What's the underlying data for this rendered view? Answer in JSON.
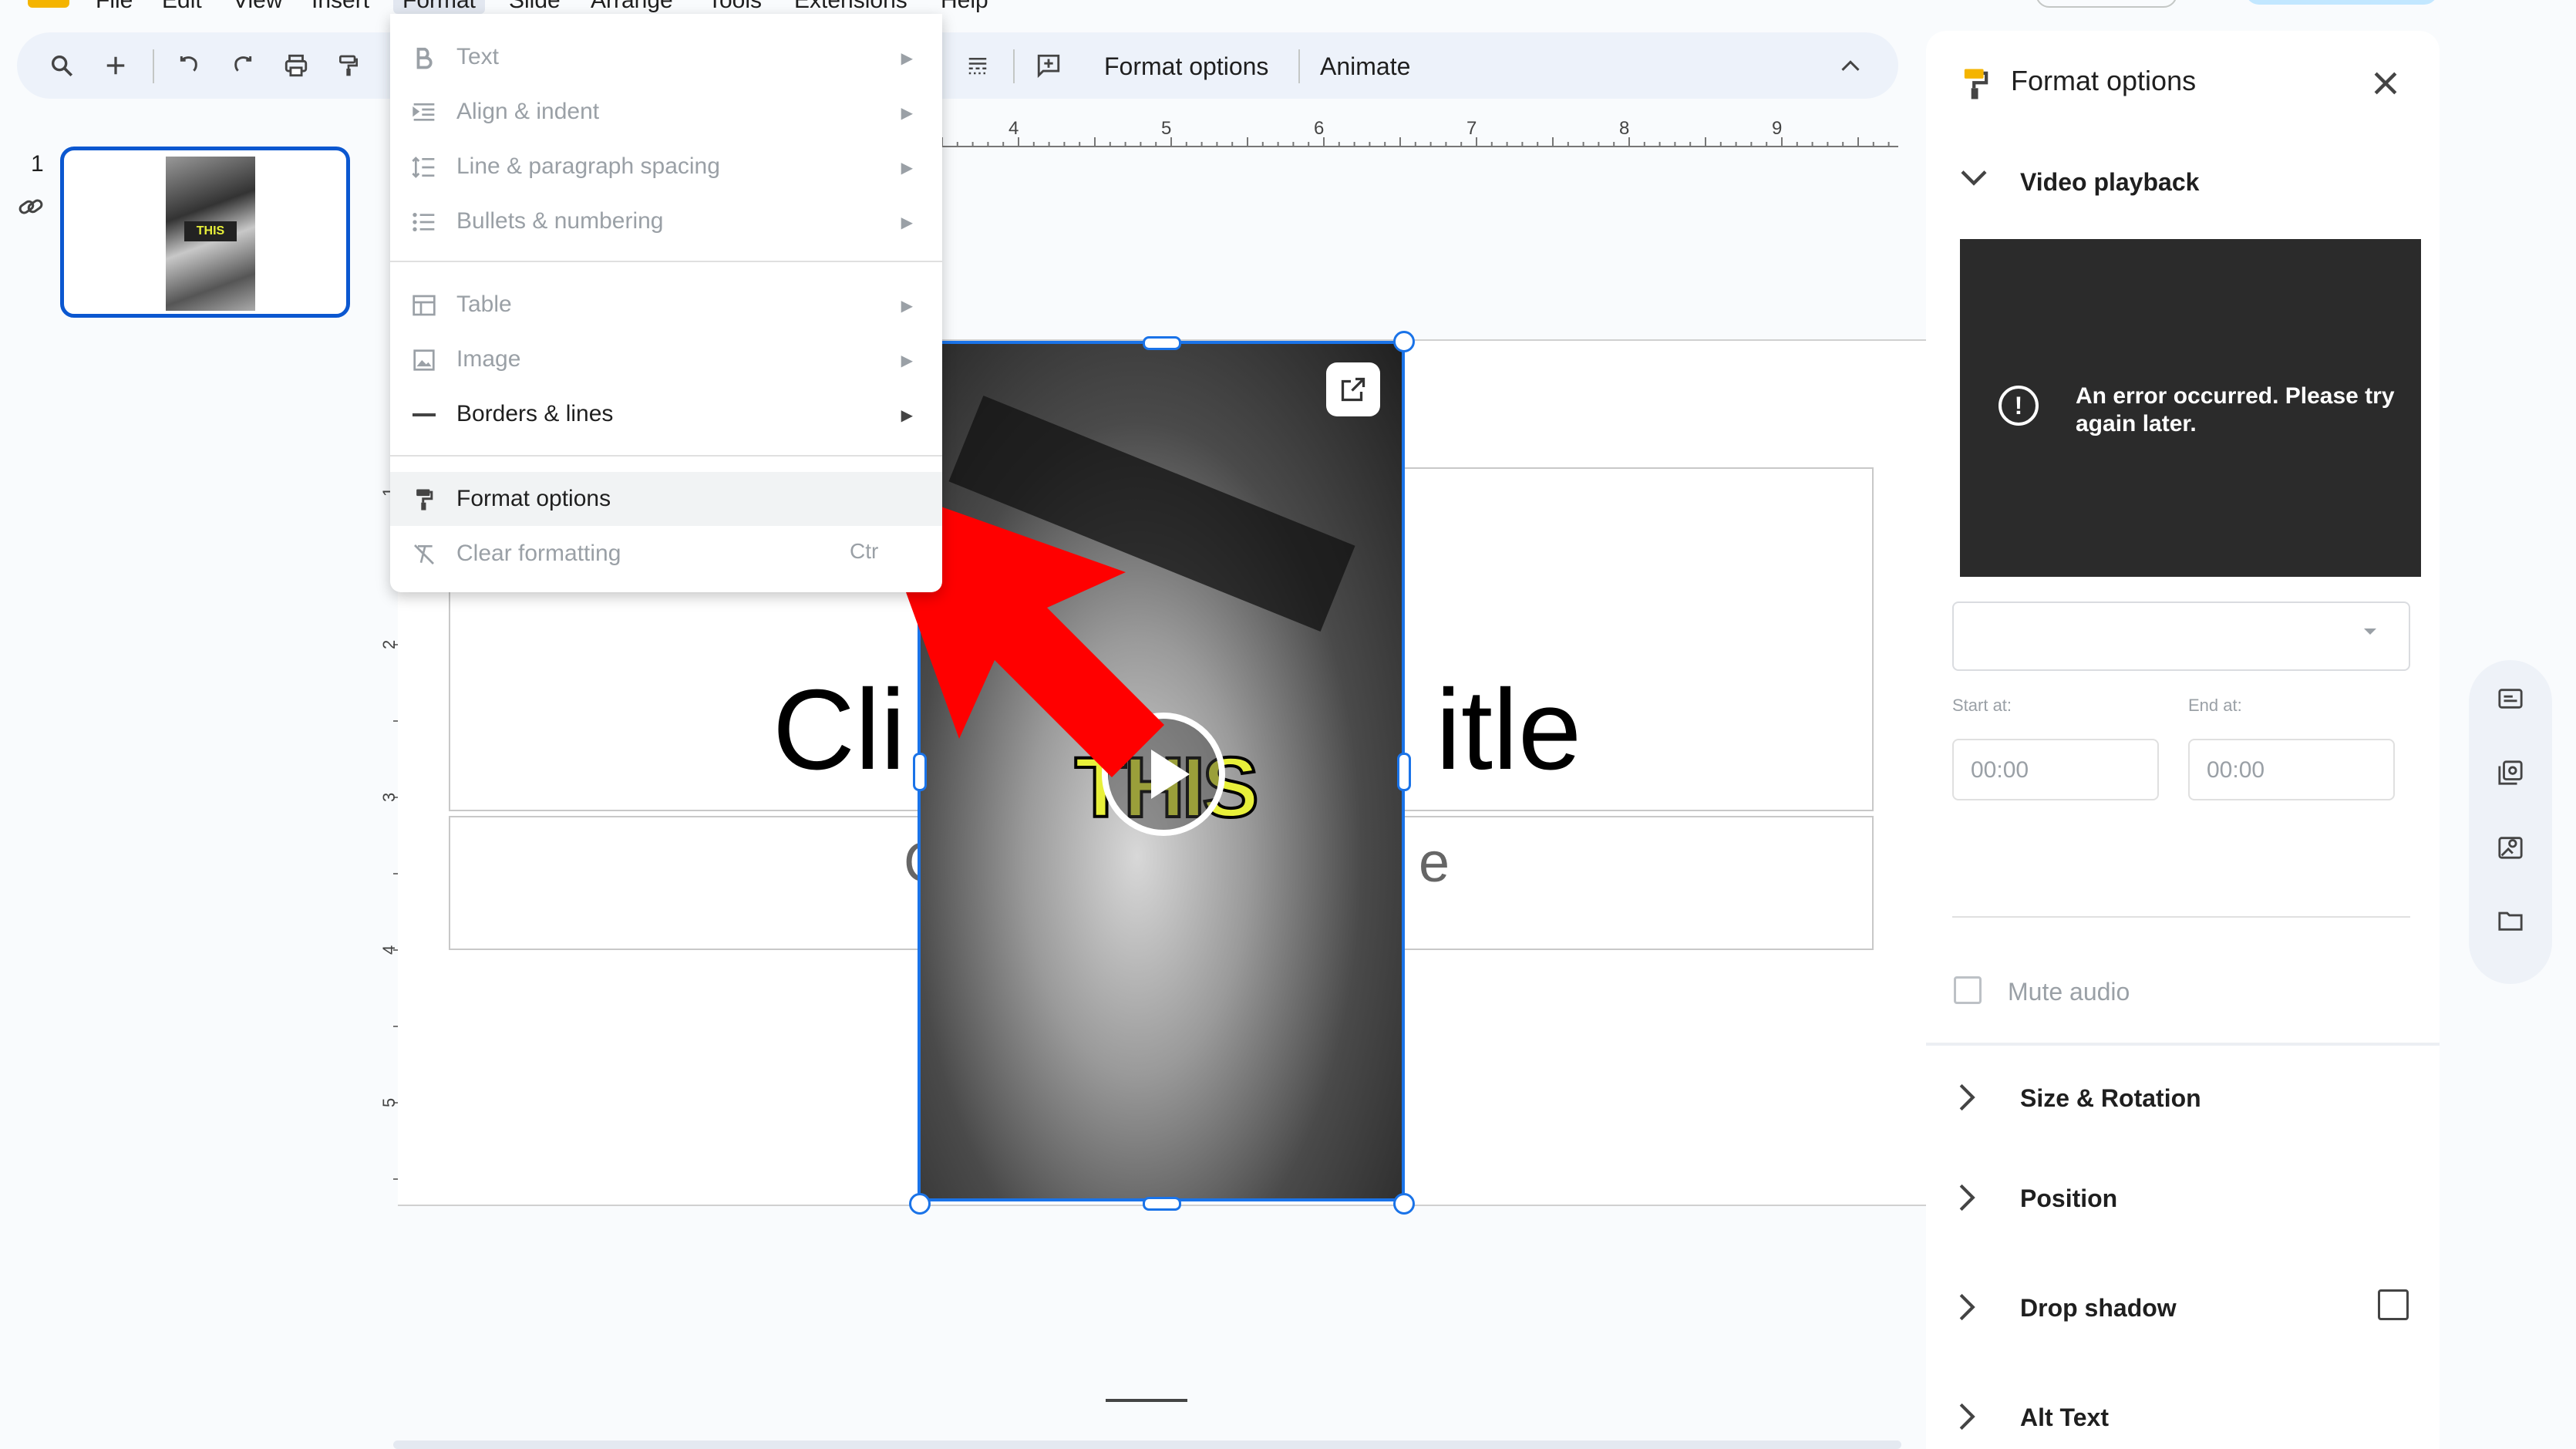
{
  "menubar": {
    "items": [
      "File",
      "Edit",
      "View",
      "Insert",
      "Format",
      "Slide",
      "Arrange",
      "Tools",
      "Extensions",
      "Help"
    ],
    "active": "Format"
  },
  "toolbar": {
    "format_options_label": "Format options",
    "animate_label": "Animate"
  },
  "filmstrip": {
    "slide_number": "1",
    "thumb_caption": "THIS"
  },
  "slide": {
    "title_fragment_left": "Cli",
    "title_fragment_right": "itle",
    "subtitle_fragment_left": "C",
    "subtitle_fragment_right": "e",
    "video_caption": "THIS"
  },
  "ruler": {
    "top_ticks": [
      "4",
      "5",
      "6",
      "7",
      "8",
      "9"
    ],
    "left_ticks": [
      "1",
      "2",
      "3",
      "4",
      "5"
    ]
  },
  "format_menu": {
    "items": [
      {
        "label": "Text",
        "icon": "bold-icon",
        "disabled": true,
        "submenu": true
      },
      {
        "label": "Align & indent",
        "icon": "align-indent-icon",
        "disabled": true,
        "submenu": true
      },
      {
        "label": "Line & paragraph spacing",
        "icon": "line-spacing-icon",
        "disabled": true,
        "submenu": true
      },
      {
        "label": "Bullets & numbering",
        "icon": "bulleted-list-icon",
        "disabled": true,
        "submenu": true
      },
      {
        "label": "Table",
        "icon": "table-icon",
        "disabled": true,
        "submenu": true
      },
      {
        "label": "Image",
        "icon": "image-icon",
        "disabled": true,
        "submenu": true
      },
      {
        "label": "Borders & lines",
        "icon": "border-line-icon",
        "disabled": false,
        "submenu": true
      },
      {
        "label": "Format options",
        "icon": "paint-format-icon",
        "disabled": false,
        "submenu": false
      },
      {
        "label": "Clear formatting",
        "icon": "clear-format-icon",
        "disabled": true,
        "submenu": false,
        "shortcut": "Ctr"
      }
    ]
  },
  "panel": {
    "title": "Format options",
    "video_playback": {
      "label": "Video playback",
      "error_message": "An error occurred. Please try again later.",
      "start_label": "Start at:",
      "end_label": "End at:",
      "start_value": "00:00",
      "end_value": "00:00",
      "mute_label": "Mute audio"
    },
    "sections": [
      "Size & Rotation",
      "Position",
      "Drop shadow",
      "Alt Text"
    ]
  },
  "colors": {
    "accent": "#0b57d0",
    "selection": "#1a73e8",
    "annotation_arrow": "#ff0000",
    "caption_yellow": "#e8f03a"
  }
}
